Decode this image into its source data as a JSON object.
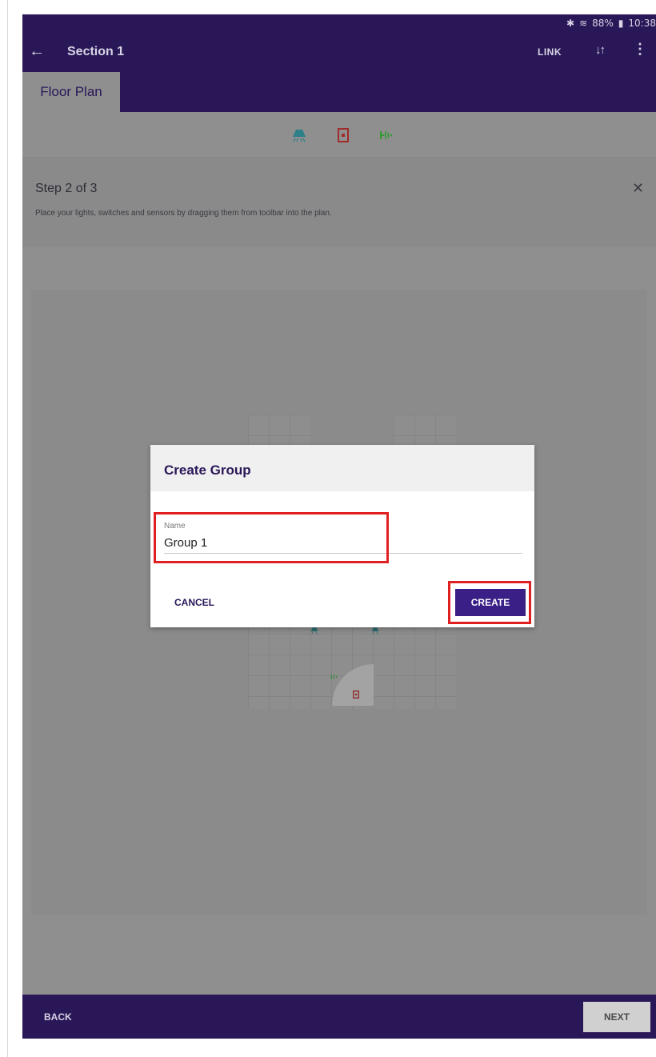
{
  "status_bar": {
    "bluetooth_icon": "bluetooth-icon",
    "wifi_icon": "wifi-icon",
    "battery_text": "88%",
    "battery_icon": "battery-icon",
    "time": "10:38"
  },
  "app_bar": {
    "title": "Section 1",
    "link_label": "LINK",
    "tab_label": "Floor Plan",
    "background": "#2a1758"
  },
  "toolbar": {
    "items": [
      "light-icon",
      "switch-icon",
      "sensor-icon"
    ]
  },
  "step": {
    "title": "Step 2 of 3",
    "description": "Place your lights, switches and sensors by dragging them from toolbar into the plan."
  },
  "dialog": {
    "title": "Create Group",
    "name_label": "Name",
    "name_value": "Group 1",
    "cancel_label": "CANCEL",
    "create_label": "CREATE",
    "accent": "#3a1f86",
    "highlight_color": "#e02020"
  },
  "bottom_bar": {
    "back_label": "BACK",
    "next_label": "NEXT"
  }
}
